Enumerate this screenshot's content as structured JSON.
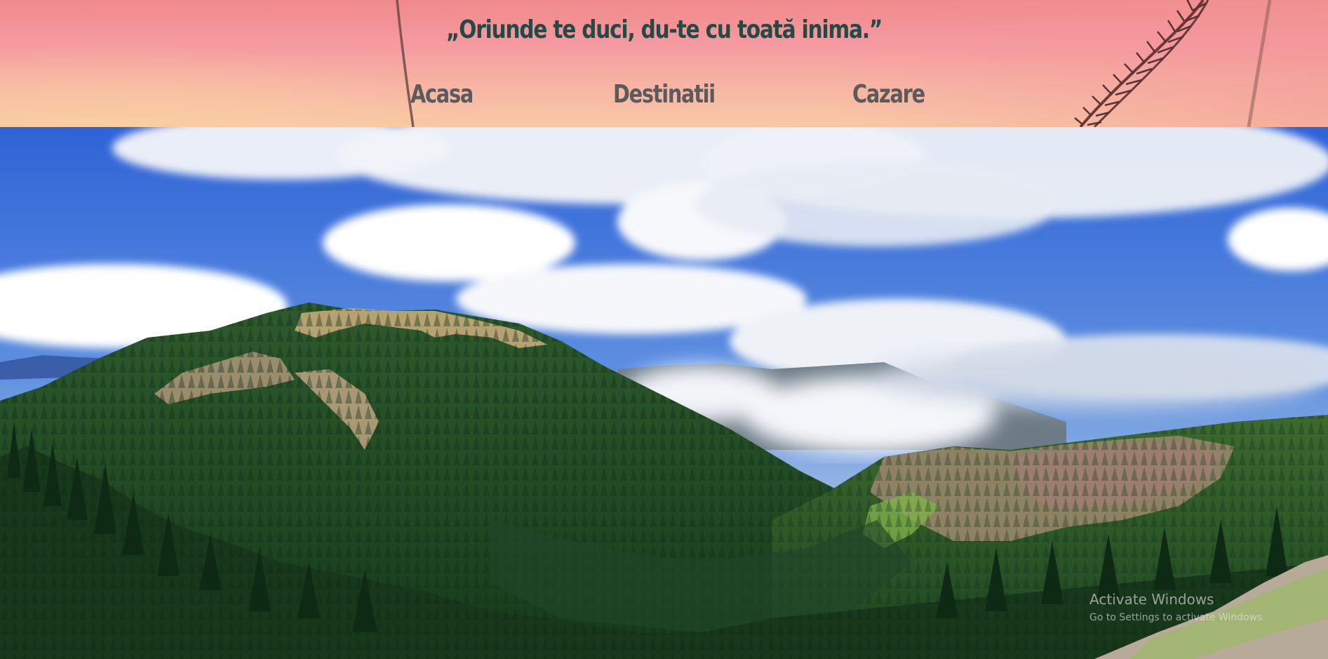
{
  "header": {
    "quote": "„Oriunde te duci, du-te cu toată inima.”",
    "nav": [
      {
        "label": "Acasa"
      },
      {
        "label": "Destinatii"
      },
      {
        "label": "Cazare"
      }
    ],
    "colors": {
      "quote_text": "#234a45",
      "nav_text": "#5c5a5b",
      "banner_top": "#f08a8c",
      "banner_bottom": "#f8c9a6"
    }
  },
  "hero": {
    "image": "mountain-landscape"
  },
  "watermark": {
    "title": "Activate Windows",
    "subtitle": "Go to Settings to activate Windows."
  }
}
